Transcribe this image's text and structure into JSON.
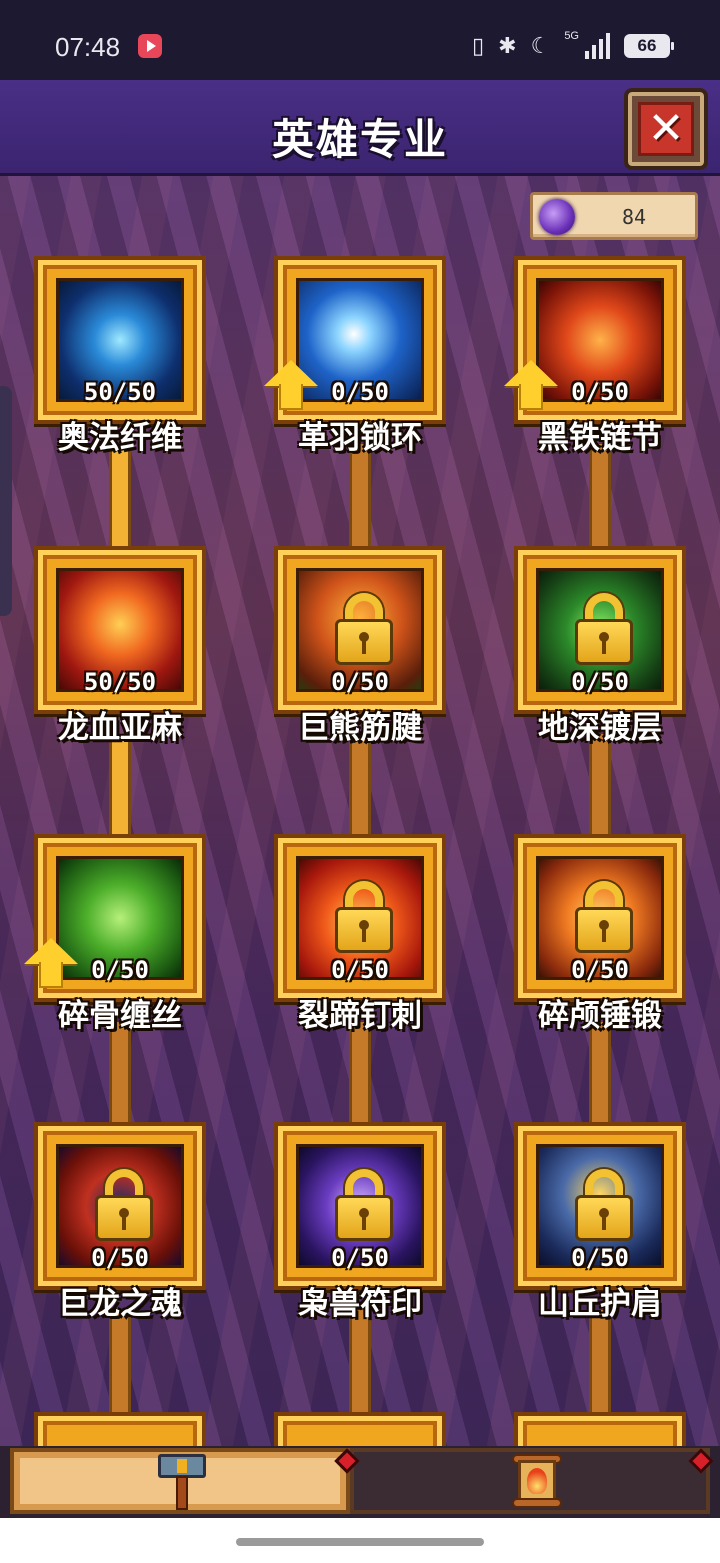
{
  "status_bar": {
    "time": "07:48",
    "network": "5G",
    "battery": "66",
    "icons": [
      "video-app-icon",
      "vibrate-icon",
      "bluetooth-icon",
      "moon-icon",
      "signal-icon",
      "battery-icon"
    ]
  },
  "header": {
    "title": "英雄专业",
    "close_icon": "close-icon"
  },
  "currency": {
    "icon": "purple-orb-icon",
    "value": "84"
  },
  "skills": [
    {
      "id": "arcane-fiber",
      "name": "奥法纤维",
      "level": "50/50",
      "locked": false,
      "upgrade": false,
      "art": "blue-arcane"
    },
    {
      "id": "feather-chain",
      "name": "革羽锁环",
      "level": "0/50",
      "locked": false,
      "upgrade": true,
      "art": "blue-feather"
    },
    {
      "id": "iron-chain",
      "name": "黑铁链节",
      "level": "0/50",
      "locked": false,
      "upgrade": true,
      "art": "red-chain"
    },
    {
      "id": "dragon-blood-linen",
      "name": "龙血亚麻",
      "level": "50/50",
      "locked": false,
      "upgrade": false,
      "art": "red-dragon"
    },
    {
      "id": "bear-tendon",
      "name": "巨熊筋腱",
      "level": "0/50",
      "locked": true,
      "upgrade": false,
      "art": "orange-forest"
    },
    {
      "id": "deep-plating",
      "name": "地深镀层",
      "level": "0/50",
      "locked": true,
      "upgrade": false,
      "art": "green-earth"
    },
    {
      "id": "bone-wire",
      "name": "碎骨缠丝",
      "level": "0/50",
      "locked": false,
      "upgrade": true,
      "art": "green-skull"
    },
    {
      "id": "hoof-spike",
      "name": "裂蹄钉刺",
      "level": "0/50",
      "locked": true,
      "upgrade": false,
      "art": "red-flame"
    },
    {
      "id": "skull-forge",
      "name": "碎颅锤锻",
      "level": "0/50",
      "locked": true,
      "upgrade": false,
      "art": "orange-hammer"
    },
    {
      "id": "dragon-soul",
      "name": "巨龙之魂",
      "level": "0/50",
      "locked": true,
      "upgrade": false,
      "art": "red-swirl"
    },
    {
      "id": "beast-seal",
      "name": "枭兽符印",
      "level": "0/50",
      "locked": true,
      "upgrade": false,
      "art": "purple-moon"
    },
    {
      "id": "hill-shoulder",
      "name": "山丘护肩",
      "level": "0/50",
      "locked": true,
      "upgrade": false,
      "art": "blue-armor"
    }
  ],
  "tabs": [
    {
      "name": "tab-equipment",
      "icon": "hammer-icon",
      "active": true
    },
    {
      "name": "tab-scroll",
      "icon": "scroll-icon",
      "active": false
    }
  ],
  "colors": {
    "frame_gold": "#f0a71f",
    "title_bar": "#4a2f86",
    "close_red": "#c8352a",
    "connector_active": "#f3b233"
  }
}
